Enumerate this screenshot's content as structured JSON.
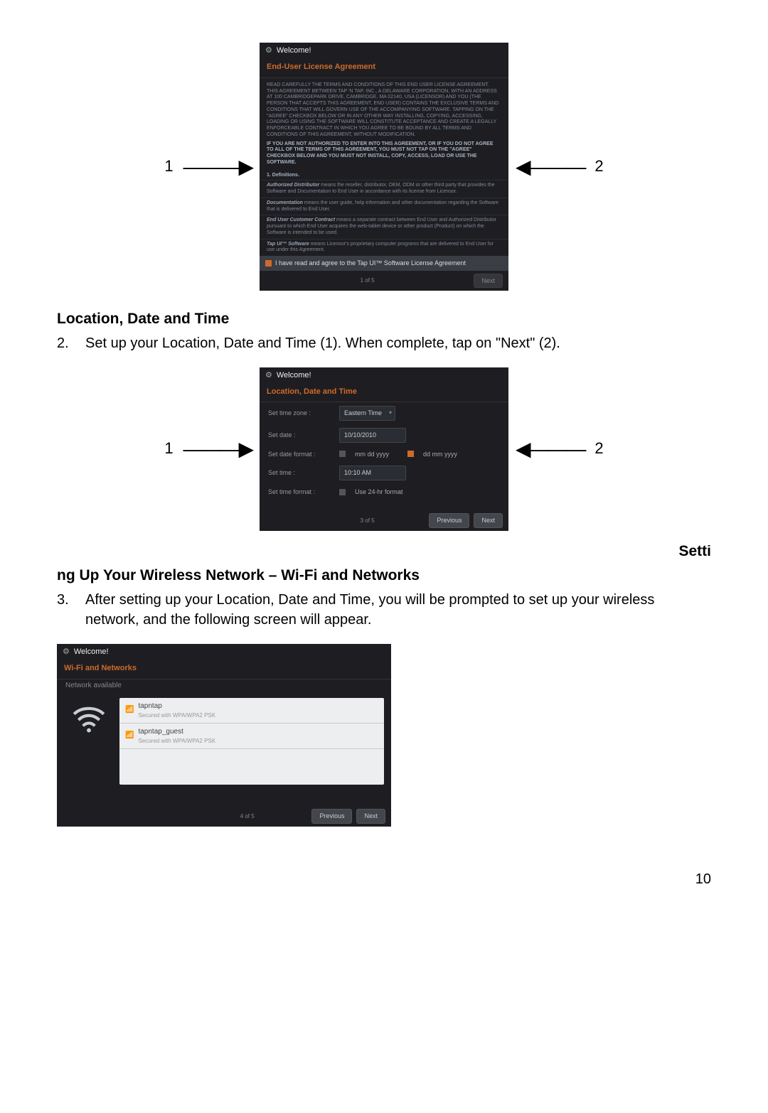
{
  "screen1": {
    "title": "Welcome!",
    "headline": "End-User License Agreement",
    "p1": "READ CAREFULLY THE TERMS AND CONDITIONS OF THIS END USER LICENSE AGREEMENT. THIS AGREEMENT BETWEEN TAP 'N TAP, INC., A DELAWARE CORPORATION, WITH AN ADDRESS AT 100 CAMBRIDGEPARK DRIVE, CAMBRIDGE, MA 02140, USA (LICENSOR) AND YOU (THE PERSON THAT ACCEPTS THIS AGREEMENT, END USER) CONTAINS THE EXCLUSIVE TERMS AND CONDITIONS THAT WILL GOVERN USE OF THE ACCOMPANYING SOFTWARE. TAPPING ON THE \"AGREE\" CHECKBOX BELOW OR IN ANY OTHER WAY INSTALLING, COPYING, ACCESSING, LOADING OR USING THE SOFTWARE WILL CONSTITUTE ACCEPTANCE AND CREATE A LEGALLY ENFORCEABLE CONTRACT IN WHICH YOU AGREE TO BE BOUND BY ALL TERMS AND CONDITIONS OF THIS AGREEMENT, WITHOUT MODIFICATION.",
    "p2": "IF YOU ARE NOT AUTHORIZED TO ENTER INTO THIS AGREEMENT, OR IF YOU DO NOT AGREE TO ALL OF THE TERMS OF THIS AGREEMENT, YOU MUST NOT TAP ON THE \"AGREE\" CHECKBOX BELOW AND YOU MUST NOT INSTALL, COPY, ACCESS, LOAD OR USE THE SOFTWARE.",
    "defs_title": "1. Definitions.",
    "def1_term": "Authorized Distributor",
    "def1_text": " means the reseller, distributor, OEM, ODM or other third party that provides the Software and Documentation to End User in accordance with its license from Licensor.",
    "def2_term": "Documentation",
    "def2_text": " means the user guide, help information and other documentation regarding the Software that is delivered to End User.",
    "def3_term": "End User Customer Contract",
    "def3_text": " means a separate contract between End User and Authorized Distributor pursuant to which End User acquires the web-tablet device or other product (Product) on which the Software is intended to be used.",
    "def4_term": "Tap UI™ Software",
    "def4_text": " means Licensor's proprietary computer programs that are delivered to End User for use under this Agreement.",
    "agree_label": "I have read and agree to the Tap UI™ Software License Agreement",
    "counter": "1 of 5",
    "next": "Next"
  },
  "callouts": {
    "one": "1",
    "two": "2"
  },
  "section2": {
    "heading": "Location, Date and Time",
    "num": "2.",
    "text": "Set up your Location, Date and Time (1).    When complete, tap on \"Next\" (2)."
  },
  "screen2": {
    "title": "Welcome!",
    "headline": "Location, Date and Time",
    "tz_label": "Set time zone :",
    "tz_value": "Eastern Time",
    "date_label": "Set date :",
    "date_value": "10/10/2010",
    "datefmt_label": "Set date format :",
    "datefmt_opt1": "mm dd yyyy",
    "datefmt_opt2": "dd mm yyyy",
    "time_label": "Set time :",
    "time_value": "10:10 AM",
    "timefmt_label": "Set time format :",
    "timefmt_opt": "Use 24-hr format",
    "counter": "3 of 5",
    "prev": "Previous",
    "next": "Next"
  },
  "section3": {
    "heading_a": "Setti",
    "heading_b": "ng Up Your Wireless Network – Wi-Fi and Networks",
    "num": "3.",
    "text": "After setting up your Location, Date and Time, you will be prompted to set up your wireless network, and the following screen will appear."
  },
  "screen3": {
    "title": "Welcome!",
    "headline": "Wi-Fi and Networks",
    "sub": "Network available",
    "net1_name": "tapntap",
    "net1_sec": "Secured with WPA/WPA2 PSK",
    "net2_name": "tapntap_guest",
    "net2_sec": "Secured with WPA/WPA2 PSK",
    "counter": "4 of 5",
    "prev": "Previous",
    "next": "Next"
  },
  "page_number": "10"
}
